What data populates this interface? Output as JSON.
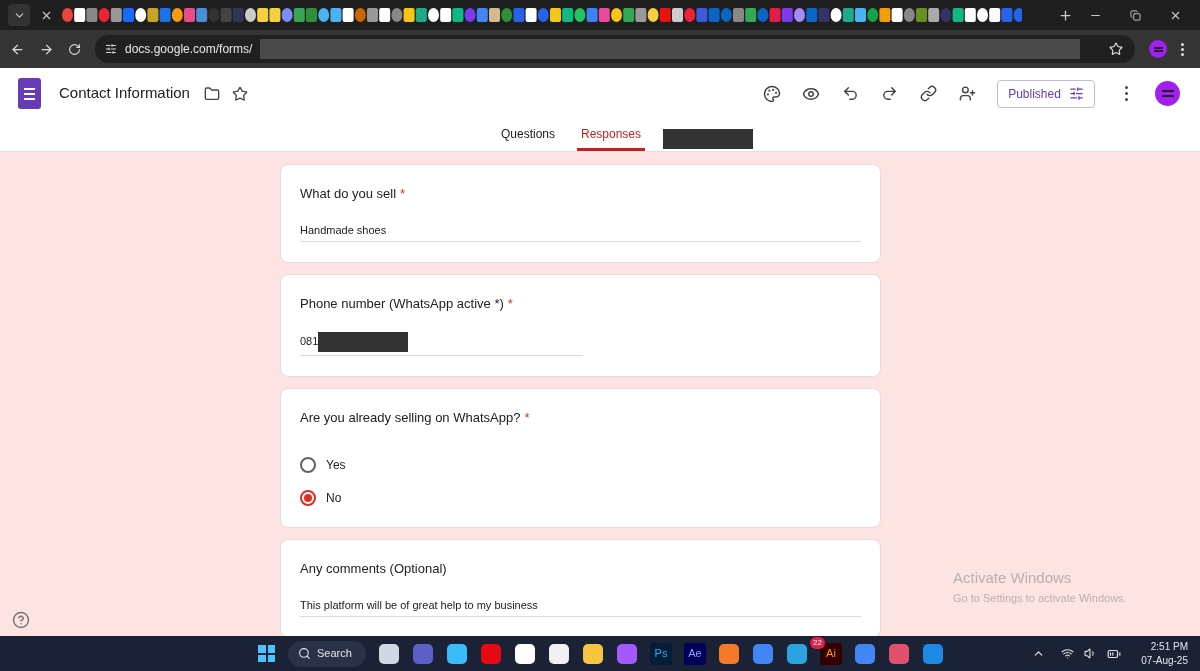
{
  "browser": {
    "url": "docs.google.com/forms/"
  },
  "form_header": {
    "title": "Contact Information",
    "publish_button": "Published",
    "tabs": [
      {
        "label": "Questions",
        "selected": false
      },
      {
        "label": "Responses",
        "selected": true
      }
    ]
  },
  "questions": [
    {
      "kind": "text",
      "title": "What do you sell",
      "required_marker": "*",
      "value": "Handmade shoes",
      "redacted": false
    },
    {
      "kind": "text",
      "title": "Phone number (WhatsApp active *)",
      "required_marker": "*",
      "value": "081",
      "redacted": true
    },
    {
      "kind": "radio",
      "title": "Are you already selling on WhatsApp?",
      "required_marker": "*",
      "options": [
        {
          "label": "Yes",
          "selected": false
        },
        {
          "label": "No",
          "selected": true
        }
      ]
    },
    {
      "kind": "text",
      "title": "Any comments (Optional)",
      "value": "This  platform will be of great help to my business",
      "redacted": false
    }
  ],
  "activation_notice": {
    "title": "Activate Windows",
    "subtitle": "Go to Settings to activate Windows."
  },
  "taskbar": {
    "search": "Search",
    "apps": [
      {
        "kind": "icon"
      },
      {
        "kind": "icon"
      },
      {
        "kind": "icon"
      },
      {
        "kind": "icon"
      },
      {
        "kind": "icon"
      },
      {
        "kind": "icon"
      },
      {
        "kind": "icon"
      },
      {
        "kind": "icon"
      },
      {
        "kind": "tile",
        "label": "Ps"
      },
      {
        "kind": "tile",
        "label": "Ae"
      },
      {
        "kind": "icon"
      },
      {
        "kind": "icon"
      },
      {
        "kind": "icon",
        "badge": "22"
      },
      {
        "kind": "tile",
        "label": "Ai"
      },
      {
        "kind": "icon"
      },
      {
        "kind": "icon"
      },
      {
        "kind": "icon"
      }
    ],
    "time": "2:51 PM",
    "date": "07-Aug-25"
  }
}
